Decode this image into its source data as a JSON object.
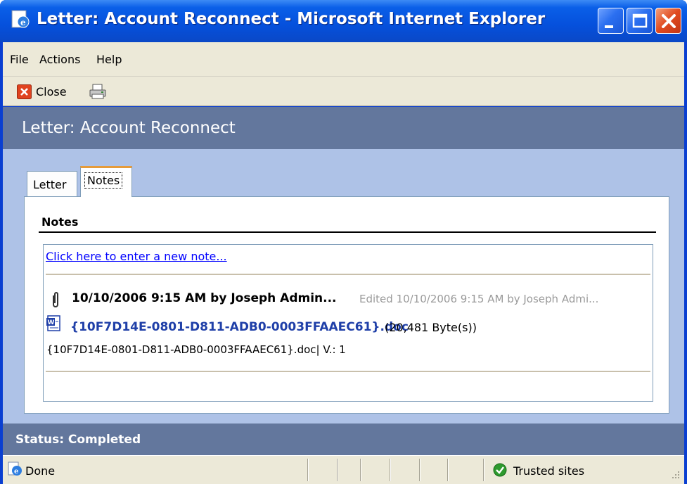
{
  "window": {
    "title": "Letter: Account Reconnect - Microsoft Internet Explorer",
    "icons": {
      "app": "ie-page-icon",
      "minimize": "minimize-icon",
      "maximize": "maximize-icon",
      "close": "close-icon"
    }
  },
  "menu": {
    "file": "File",
    "actions": "Actions",
    "help": "Help"
  },
  "toolbar": {
    "close_label": "Close",
    "icons": [
      "close-icon",
      "print-icon"
    ]
  },
  "header": {
    "title": "Letter: Account Reconnect"
  },
  "tabs": [
    {
      "label": "Letter",
      "active": false
    },
    {
      "label": "Notes",
      "active": true
    }
  ],
  "notes": {
    "heading": "Notes",
    "new_note_link": "Click here to enter a new note...",
    "entries": [
      {
        "header": "10/10/2006 9:15 AM by Joseph Admin...",
        "edited": "Edited 10/10/2006 9:15 AM by Joseph Admi...",
        "attachment": {
          "filename": "{10F7D14E-0801-D811-ADB0-0003FFAAEC61}.doc",
          "size": "(20,481 Byte(s))",
          "version_line": "{10F7D14E-0801-D811-ADB0-0003FFAAEC61}.doc| V.: 1"
        }
      }
    ]
  },
  "status_band": {
    "text": "Status: Completed"
  },
  "ie_status": {
    "left_text": "Done",
    "zone_text": "Trusted sites"
  },
  "colors": {
    "header_band": "#63779d",
    "main_bg": "#aec2e7",
    "titlebar": "#0550dc",
    "link": "#0000ff",
    "doc_link": "#1f3fa8"
  }
}
